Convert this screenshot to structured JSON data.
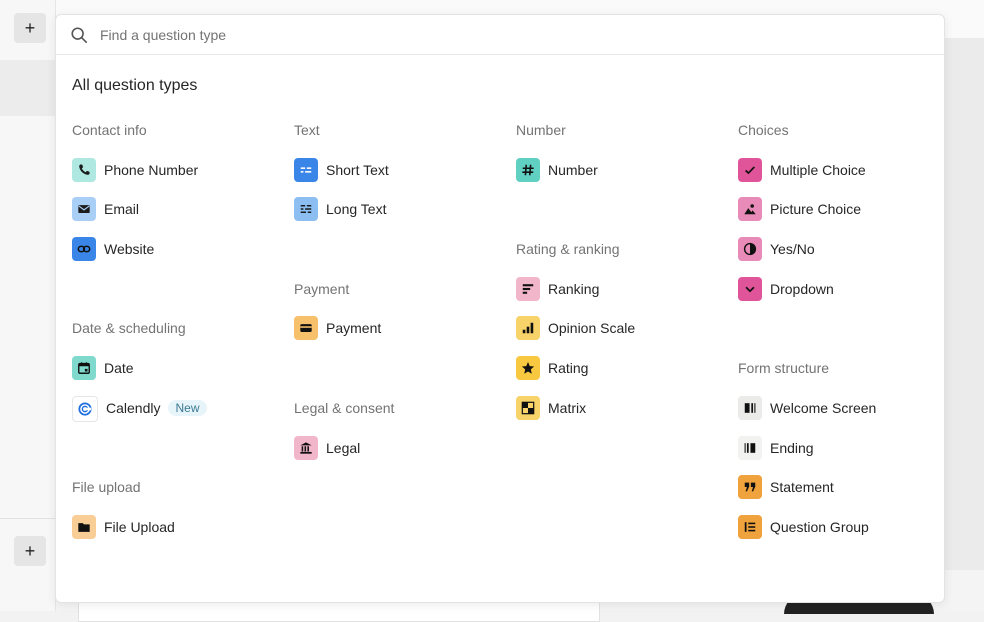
{
  "sidebar": {
    "top_button": "+",
    "bottom_button": "+"
  },
  "search": {
    "placeholder": "Find a question type",
    "value": ""
  },
  "heading": "All question types",
  "columns": [
    {
      "groups": [
        {
          "title": "Contact info",
          "items": [
            {
              "label": "Phone Number",
              "icon": "phone-icon",
              "color": "#aee8e0"
            },
            {
              "label": "Email",
              "icon": "envelope-icon",
              "color": "#a9cff6"
            },
            {
              "label": "Website",
              "icon": "link-icon",
              "color": "#3a86e8"
            }
          ]
        },
        {
          "title": "Date & scheduling",
          "items": [
            {
              "label": "Date",
              "icon": "calendar-icon",
              "color": "#7fd9cd"
            },
            {
              "label": "Calendly",
              "icon": "calendly-icon",
              "color": "#ffffff",
              "badge": "New"
            }
          ]
        },
        {
          "title": "File upload",
          "items": [
            {
              "label": "File Upload",
              "icon": "folder-icon",
              "color": "#f9cd96"
            }
          ]
        }
      ]
    },
    {
      "groups": [
        {
          "title": "Text",
          "items": [
            {
              "label": "Short Text",
              "icon": "short-text-icon",
              "color": "#3a86e8"
            },
            {
              "label": "Long Text",
              "icon": "long-text-icon",
              "color": "#8dbef2"
            }
          ]
        },
        {
          "title": "Payment",
          "items": [
            {
              "label": "Payment",
              "icon": "credit-card-icon",
              "color": "#f7c06a"
            }
          ]
        },
        {
          "title": "Legal & consent",
          "items": [
            {
              "label": "Legal",
              "icon": "bank-icon",
              "color": "#f2b6cb"
            }
          ]
        }
      ]
    },
    {
      "groups": [
        {
          "title": "Number",
          "items": [
            {
              "label": "Number",
              "icon": "hash-icon",
              "color": "#5fd0c2"
            }
          ]
        },
        {
          "title": "Rating & ranking",
          "items": [
            {
              "label": "Ranking",
              "icon": "ranking-icon",
              "color": "#f2b6cb"
            },
            {
              "label": "Opinion Scale",
              "icon": "bar-chart-icon",
              "color": "#f8d36a"
            },
            {
              "label": "Rating",
              "icon": "star-icon",
              "color": "#f8c940"
            },
            {
              "label": "Matrix",
              "icon": "matrix-icon",
              "color": "#f8d36a"
            }
          ]
        }
      ]
    },
    {
      "groups": [
        {
          "title": "Choices",
          "items": [
            {
              "label": "Multiple Choice",
              "icon": "check-icon",
              "color": "#e0559a"
            },
            {
              "label": "Picture Choice",
              "icon": "image-icon",
              "color": "#e88bb8"
            },
            {
              "label": "Yes/No",
              "icon": "half-circle-icon",
              "color": "#e88bb8"
            },
            {
              "label": "Dropdown",
              "icon": "chevron-down-icon",
              "color": "#e0559a"
            }
          ]
        },
        {
          "title": "Form structure",
          "items": [
            {
              "label": "Welcome Screen",
              "icon": "welcome-screen-icon",
              "color": "#ebebea"
            },
            {
              "label": "Ending",
              "icon": "ending-icon",
              "color": "#f2f2f1"
            },
            {
              "label": "Statement",
              "icon": "quote-icon",
              "color": "#f0a23c"
            },
            {
              "label": "Question Group",
              "icon": "question-group-icon",
              "color": "#f0a23c"
            }
          ]
        }
      ]
    }
  ]
}
